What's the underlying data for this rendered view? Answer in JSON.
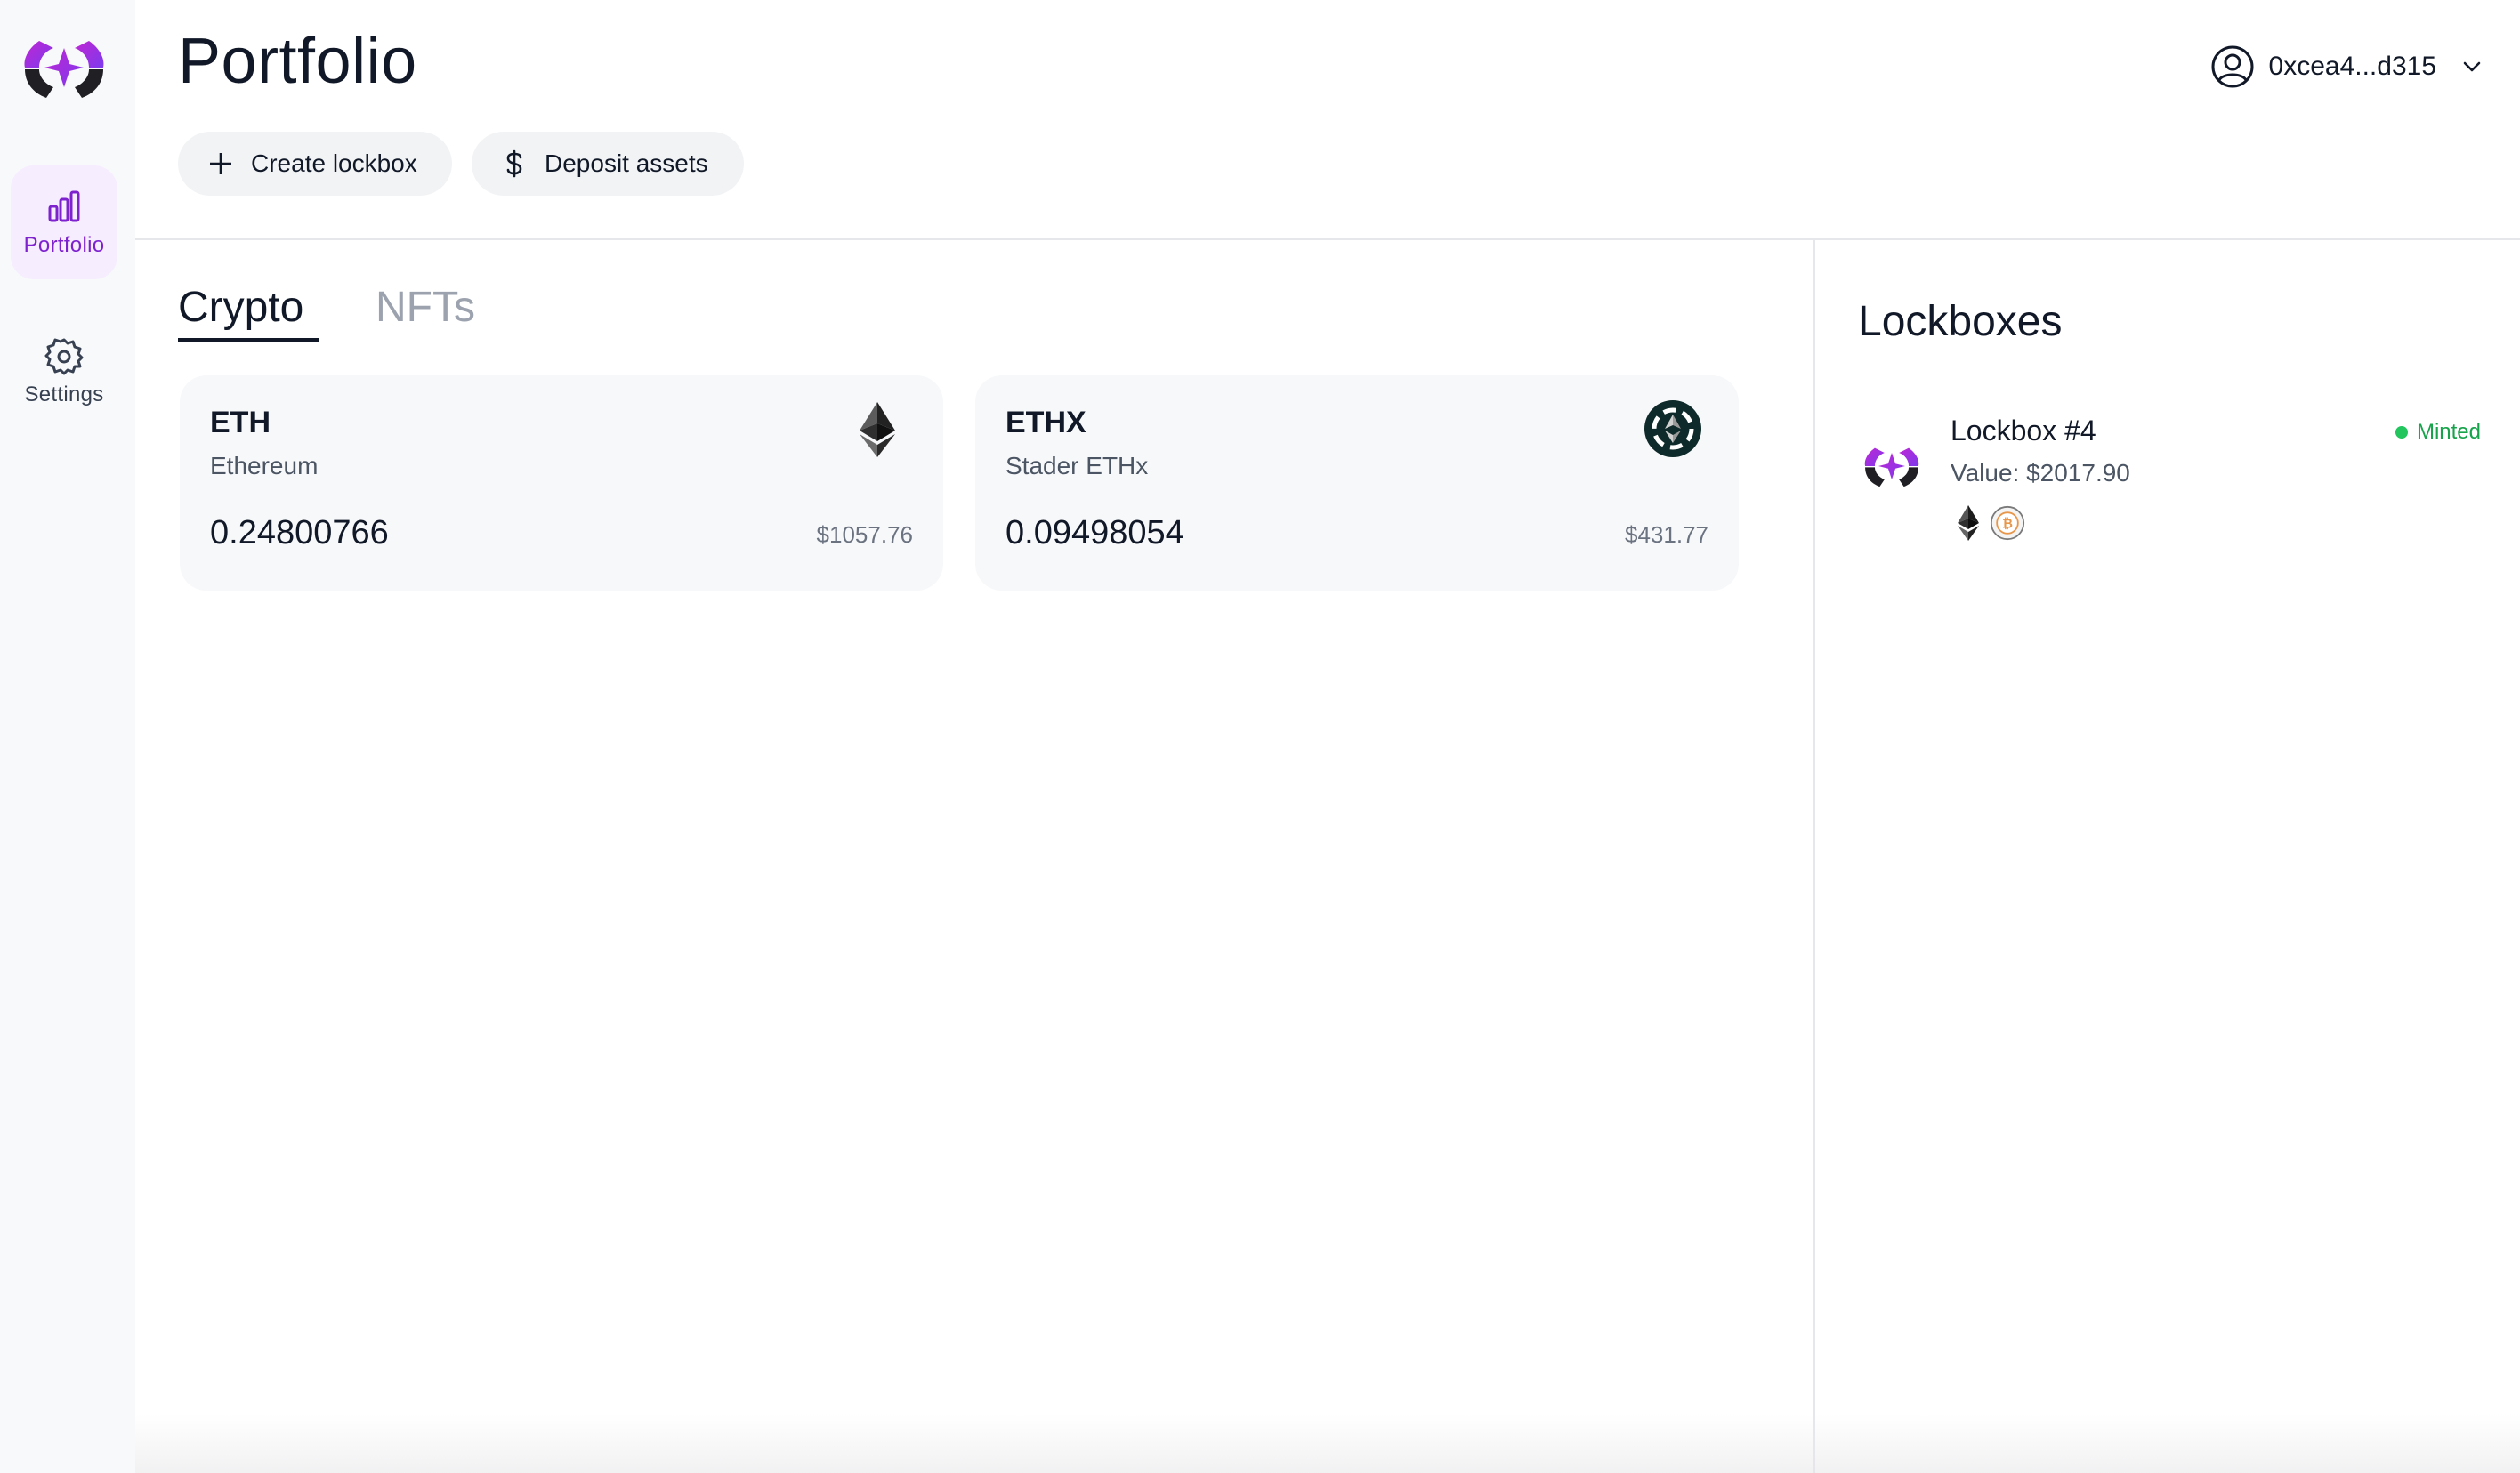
{
  "sidebar": {
    "items": [
      {
        "label": "Portfolio",
        "icon": "bar-chart-icon",
        "active": true
      },
      {
        "label": "Settings",
        "icon": "gear-icon",
        "active": false
      }
    ]
  },
  "header": {
    "title": "Portfolio",
    "actions": {
      "create_label": "Create lockbox",
      "deposit_label": "Deposit assets"
    },
    "account": {
      "address": "0xcea4...d315"
    }
  },
  "tabs": [
    {
      "label": "Crypto",
      "active": true
    },
    {
      "label": "NFTs",
      "active": false
    }
  ],
  "assets": [
    {
      "symbol": "ETH",
      "name": "Ethereum",
      "amount": "0.24800766",
      "value": "$1057.76",
      "icon": "ethereum-icon"
    },
    {
      "symbol": "ETHX",
      "name": "Stader ETHx",
      "amount": "0.09498054",
      "value": "$431.77",
      "icon": "ethx-icon"
    }
  ],
  "lockboxes": {
    "title": "Lockboxes",
    "items": [
      {
        "name": "Lockbox #4",
        "value": "Value: $2017.90",
        "status": "Minted",
        "assets": [
          "ethereum-icon",
          "bitcoin-icon"
        ]
      }
    ]
  },
  "colors": {
    "accent": "#9333ea",
    "active_nav_bg": "#f6eefe",
    "status_green": "#22c55e"
  }
}
